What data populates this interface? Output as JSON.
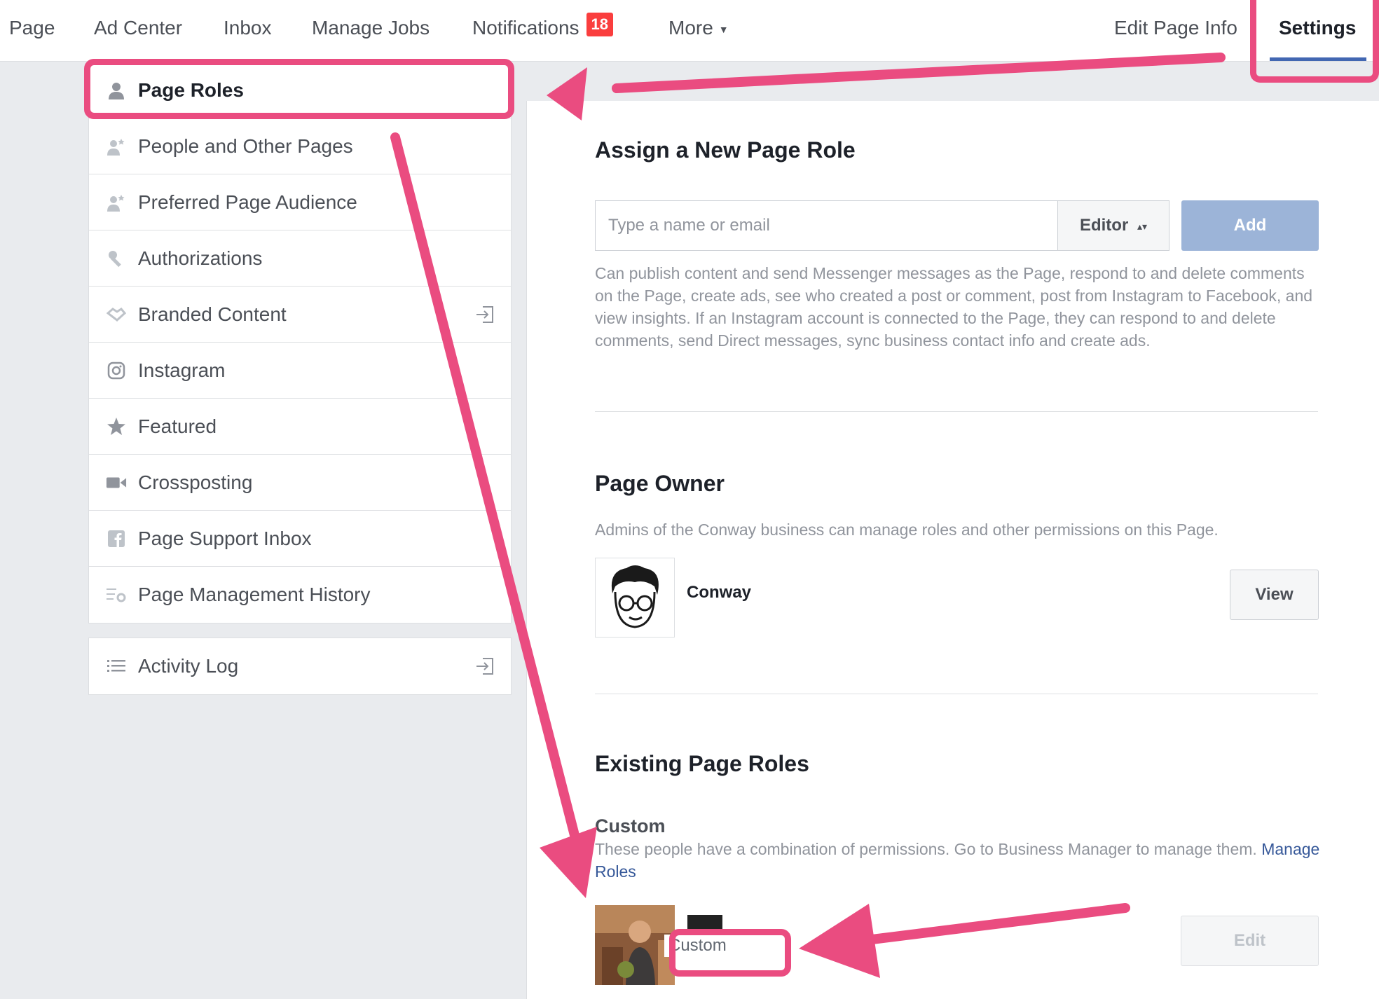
{
  "topnav": {
    "items": [
      "Page",
      "Ad Center",
      "Inbox",
      "Manage Jobs",
      "Notifications",
      "More",
      "Edit Page Info",
      "Settings"
    ],
    "notifications_count": "18",
    "active": "Settings"
  },
  "sidebar": {
    "items": [
      {
        "label": "Page Roles",
        "icon": "person-icon"
      },
      {
        "label": "People and Other Pages",
        "icon": "people-icon"
      },
      {
        "label": "Preferred Page Audience",
        "icon": "people-icon"
      },
      {
        "label": "Authorizations",
        "icon": "wrench-icon"
      },
      {
        "label": "Branded Content",
        "icon": "handshake-icon"
      },
      {
        "label": "Instagram",
        "icon": "instagram-icon"
      },
      {
        "label": "Featured",
        "icon": "star-icon"
      },
      {
        "label": "Crossposting",
        "icon": "video-camera-icon"
      },
      {
        "label": "Page Support Inbox",
        "icon": "facebook-icon"
      },
      {
        "label": "Page Management History",
        "icon": "list-gear-icon"
      }
    ],
    "activity_log": "Activity Log"
  },
  "assign": {
    "title": "Assign a New Page Role",
    "placeholder": "Type a name or email",
    "role": "Editor",
    "add": "Add",
    "description": "Can publish content and send Messenger messages as the Page, respond to and delete comments on the Page, create ads, see who created a post or comment, post from Instagram to Facebook, and view insights. If an Instagram account is connected to the Page, they can respond to and delete comments, send Direct messages, sync business contact info and create ads."
  },
  "owner": {
    "title": "Page Owner",
    "description": "Admins of the Conway business can manage roles and other permissions on this Page.",
    "name": "Conway",
    "view": "View"
  },
  "existing": {
    "title": "Existing Page Roles",
    "custom_title": "Custom",
    "custom_desc": "These people have a combination of permissions. Go to Business Manager to manage them.",
    "manage_link": "Manage Roles",
    "person_role": "Custom",
    "edit": "Edit"
  },
  "colors": {
    "accent": "#4267b2",
    "annotation": "#ea4c80",
    "badge": "#fa3e3e",
    "add_button": "#9cb4d8",
    "link": "#365899"
  }
}
